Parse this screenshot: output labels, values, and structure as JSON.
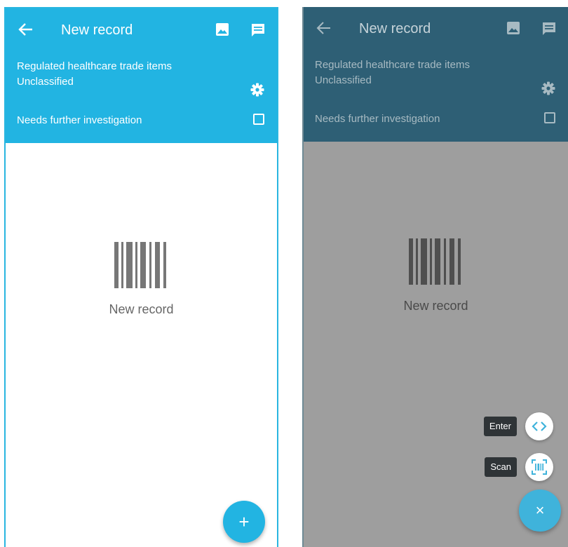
{
  "screens": [
    {
      "title": "New record",
      "subtitle_line1": "Regulated healthcare trade items",
      "subtitle_line2": "Unclassified",
      "investigation_label": "Needs further investigation",
      "empty_label": "New record",
      "fab_icon": "+"
    },
    {
      "title": "New record",
      "subtitle_line1": "Regulated healthcare trade items",
      "subtitle_line2": "Unclassified",
      "investigation_label": "Needs further investigation",
      "empty_label": "New record",
      "speed_dial": {
        "enter_label": "Enter",
        "scan_label": "Scan",
        "close_icon": "×"
      }
    }
  ],
  "icons": [
    "back-arrow-icon",
    "image-icon",
    "comment-icon",
    "gear-icon",
    "barcode-icon",
    "code-brackets-icon",
    "barcode-scan-icon"
  ],
  "colors": {
    "accent": "#22b4e2",
    "dimmed_appbar": "#2e5f75",
    "scrim": "#9e9e9e",
    "tooltip": "#2f3437"
  }
}
